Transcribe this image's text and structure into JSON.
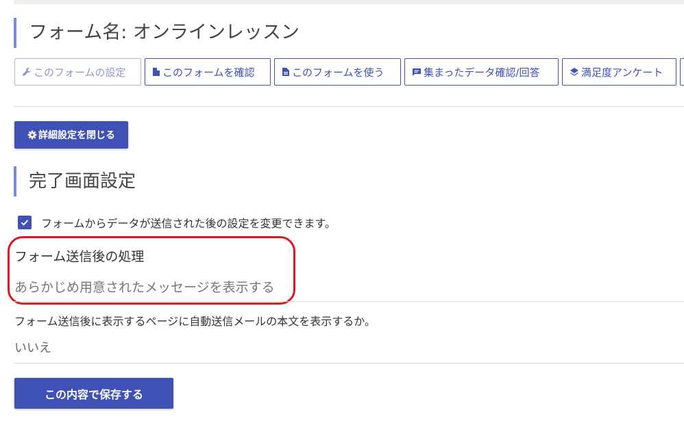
{
  "form_title": "フォーム名: オンラインレッスン",
  "tabs": [
    {
      "label": "このフォームの設定",
      "icon": "wrench-icon"
    },
    {
      "label": "このフォームを確認",
      "icon": "document-icon"
    },
    {
      "label": "このフォームを使う",
      "icon": "document-lines-icon"
    },
    {
      "label": "集まったデータ確認/回答",
      "icon": "message-icon"
    },
    {
      "label": "満足度アンケート",
      "icon": "layers-icon"
    }
  ],
  "detail_button": {
    "label": "詳細設定を閉じる",
    "icon": "gear-icon"
  },
  "section_title": "完了画面設定",
  "checkbox": {
    "label": "フォームからデータが送信された後の設定を変更できます。",
    "checked": true
  },
  "post_submit": {
    "label": "フォーム送信後の処理",
    "value": "あらかじめ用意されたメッセージを表示する"
  },
  "auto_mail": {
    "label": "フォーム送信後に表示するページに自動送信メールの本文を表示するか。",
    "value": "いいえ"
  },
  "save_button": {
    "label": "この内容で保存する"
  },
  "colors": {
    "accent": "#3f51b5",
    "heading_bar": "#7f8bd0",
    "highlight": "#e3141d"
  }
}
